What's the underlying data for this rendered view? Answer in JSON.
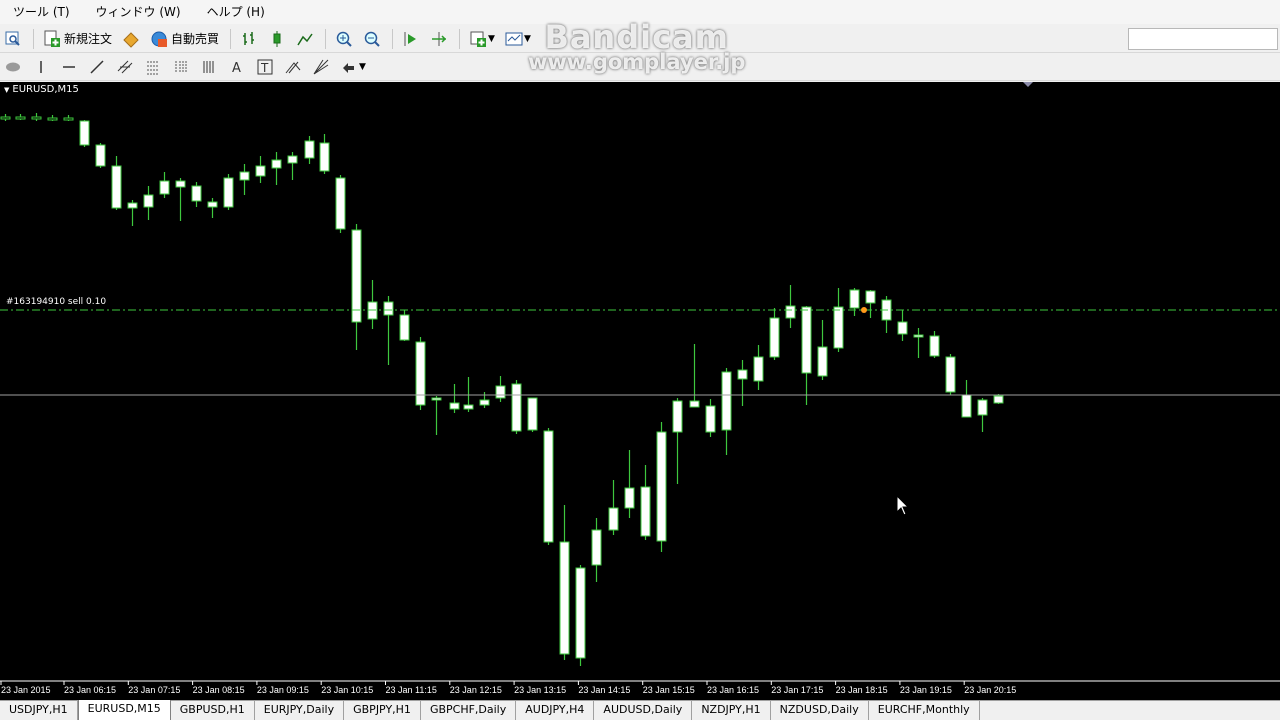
{
  "menu": [
    "ツール (T)",
    "ウィンドウ (W)",
    "ヘルプ (H)"
  ],
  "toolbar": {
    "new_order_label": "新規注文",
    "auto_trading_label": "自動売買"
  },
  "watermark": {
    "line1": "Bandicam",
    "line2": "www.gomplayer.jp"
  },
  "chart": {
    "title": "EURUSD,M15",
    "order_label": "#163194910 sell 0.10",
    "time_labels": [
      "23 Jan 2015",
      "23 Jan 06:15",
      "23 Jan 07:15",
      "23 Jan 08:15",
      "23 Jan 09:15",
      "23 Jan 10:15",
      "23 Jan 11:15",
      "23 Jan 12:15",
      "23 Jan 13:15",
      "23 Jan 14:15",
      "23 Jan 15:15",
      "23 Jan 16:15",
      "23 Jan 17:15",
      "23 Jan 18:15",
      "23 Jan 19:15",
      "23 Jan 20:15"
    ],
    "colors": {
      "background": "#000000",
      "bull_body": "#000000",
      "bear_body": "#ffffff",
      "wick": "#3ec83e",
      "order_line": "#3ec83e",
      "bid_line": "#a0a0a0"
    }
  },
  "tabs": [
    "USDJPY,H1",
    "EURUSD,M15",
    "GBPUSD,H1",
    "EURJPY,Daily",
    "GBPJPY,H1",
    "GBPCHF,Daily",
    "AUDJPY,H4",
    "AUDUSD,Daily",
    "NZDJPY,H1",
    "NZDUSD,Daily",
    "EURCHF,Monthly"
  ],
  "active_tab": 1
}
